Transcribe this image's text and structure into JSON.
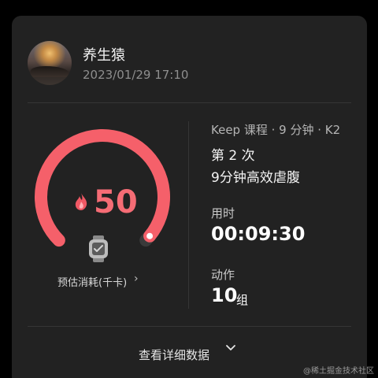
{
  "header": {
    "username": "养生猿",
    "datetime": "2023/01/29 17:10"
  },
  "calories": {
    "value": "50",
    "label": "预估消耗(千卡)",
    "chevron": "›",
    "gauge_fraction": 0.98
  },
  "course": {
    "meta": "Keep 课程 · 9 分钟 · K2",
    "count": "第 2 次",
    "name": "9分钟高效虐腹"
  },
  "stats": {
    "duration_label": "用时",
    "duration_value": "00:09:30",
    "actions_label": "动作",
    "actions_value": "10",
    "actions_unit": "组"
  },
  "footer": {
    "details_label": "查看详细数据"
  },
  "watermark": "@稀土掘金技术社区",
  "icons": {
    "flame": "flame-icon",
    "watch": "watch-icon",
    "chevron_right": "chevron-right-icon",
    "chevron_down": "chevron-down-icon"
  },
  "colors": {
    "accent": "#f56c75",
    "card": "#222222",
    "background": "#000000"
  }
}
